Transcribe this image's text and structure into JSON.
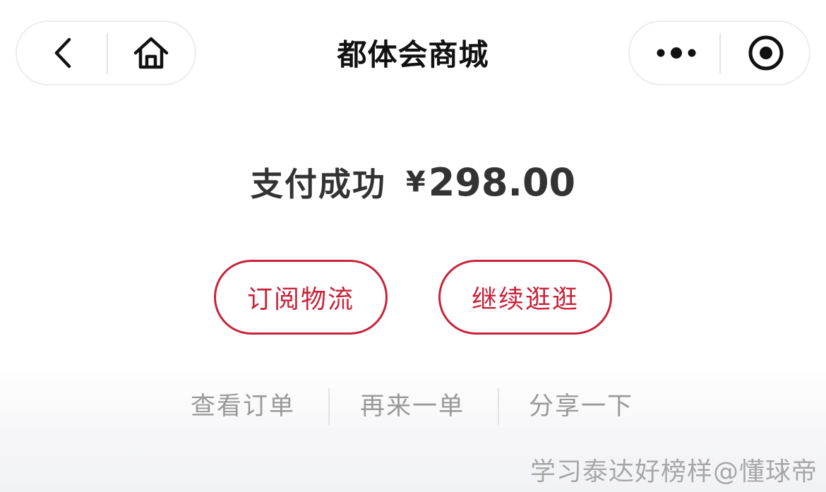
{
  "header": {
    "title": "都体会商城",
    "left_capsule": {
      "back_icon": "chevron-left-icon",
      "home_icon": "home-icon"
    },
    "right_capsule": {
      "more_icon": "more-dots-icon",
      "close_icon": "target-close-icon"
    }
  },
  "payment": {
    "status_label": "支付成功",
    "currency_symbol": "¥",
    "amount": "298.00"
  },
  "actions": {
    "primary_buttons": [
      {
        "label": "订阅物流"
      },
      {
        "label": "继续逛逛"
      }
    ],
    "text_links": [
      {
        "label": "查看订单"
      },
      {
        "label": "再来一单"
      },
      {
        "label": "分享一下"
      }
    ]
  },
  "watermark": {
    "text": "学习泰达好榜样@懂球帝"
  },
  "colors": {
    "accent": "#c8233a",
    "muted_text": "#999999",
    "title_text": "#111111"
  }
}
